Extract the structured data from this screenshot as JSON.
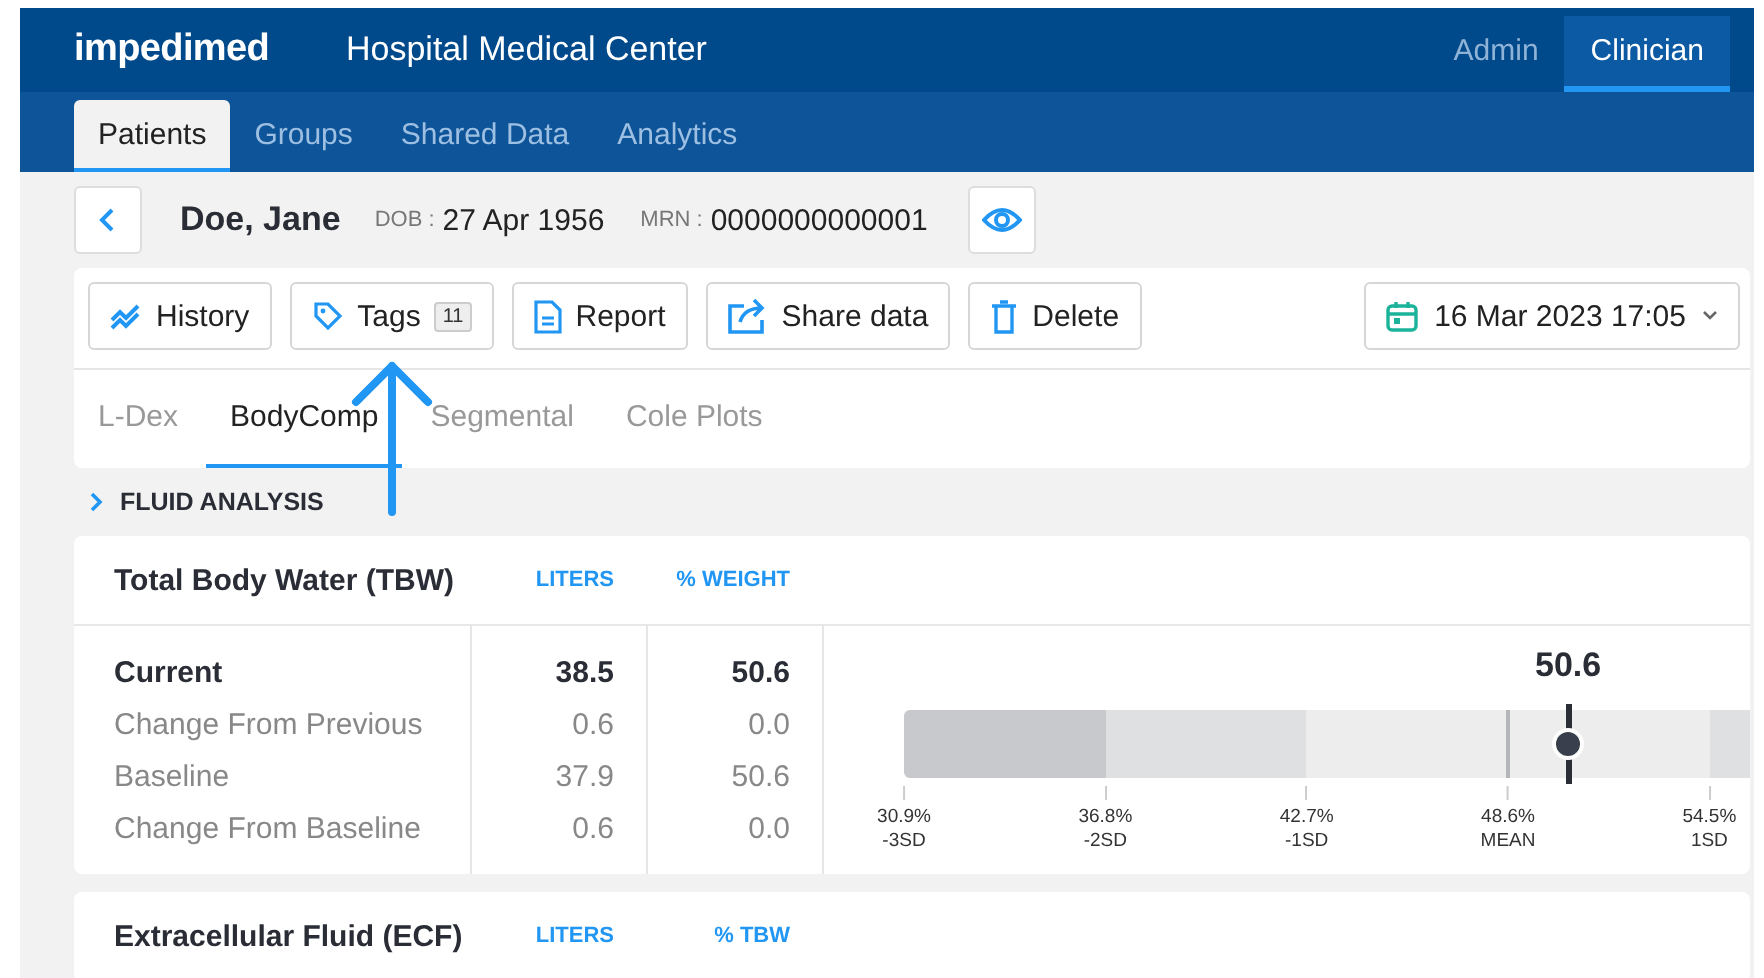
{
  "header": {
    "logo": "impedimed",
    "title": "Hospital Medical Center",
    "roles": [
      {
        "label": "Admin",
        "selected": false
      },
      {
        "label": "Clinician",
        "selected": true
      }
    ]
  },
  "nav_tabs": [
    {
      "label": "Patients",
      "selected": true
    },
    {
      "label": "Groups",
      "selected": false
    },
    {
      "label": "Shared Data",
      "selected": false
    },
    {
      "label": "Analytics",
      "selected": false
    }
  ],
  "patient": {
    "name": "Doe, Jane",
    "dob_label": "DOB :",
    "dob": "27 Apr 1956",
    "mrn_label": "MRN :",
    "mrn": "0000000000001"
  },
  "toolbar": {
    "buttons": [
      {
        "kind": "history",
        "label": "History"
      },
      {
        "kind": "tags",
        "label": "Tags",
        "count": "11"
      },
      {
        "kind": "report",
        "label": "Report"
      },
      {
        "kind": "share",
        "label": "Share data"
      },
      {
        "kind": "delete",
        "label": "Delete"
      }
    ],
    "date": "16 Mar 2023 17:05"
  },
  "view_tabs": [
    {
      "label": "L-Dex",
      "selected": false
    },
    {
      "label": "BodyComp",
      "selected": true
    },
    {
      "label": "Segmental",
      "selected": false
    },
    {
      "label": "Cole Plots",
      "selected": false
    }
  ],
  "section": {
    "title": "FLUID ANALYSIS"
  },
  "panels": [
    {
      "title": "Total Body Water (TBW)",
      "units": [
        "LITERS",
        "% WEIGHT"
      ],
      "rows": [
        {
          "label": "Current",
          "values": [
            "38.5",
            "50.6"
          ],
          "current": true
        },
        {
          "label": "Change From Previous",
          "values": [
            "0.6",
            "0.0"
          ],
          "current": false
        },
        {
          "label": "Baseline",
          "values": [
            "37.9",
            "50.6"
          ],
          "current": false
        },
        {
          "label": "Change From Baseline",
          "values": [
            "0.6",
            "0.0"
          ],
          "current": false
        }
      ],
      "gauge": {
        "value": "50.6",
        "level": 0.785,
        "ticks": [
          {
            "kind": "sd",
            "value": "30.9%",
            "label": "-3SD"
          },
          {
            "kind": "sd",
            "value": "36.8%",
            "label": "-2SD"
          },
          {
            "kind": "sd",
            "value": "42.7%",
            "label": "-1SD"
          },
          {
            "kind": "mean",
            "value": "48.6%",
            "label": "MEAN"
          },
          {
            "kind": "sd",
            "value": "54.5%",
            "label": "1SD"
          }
        ]
      }
    },
    {
      "title": "Extracellular Fluid (ECF)",
      "units": [
        "LITERS",
        "% TBW"
      ]
    }
  ]
}
